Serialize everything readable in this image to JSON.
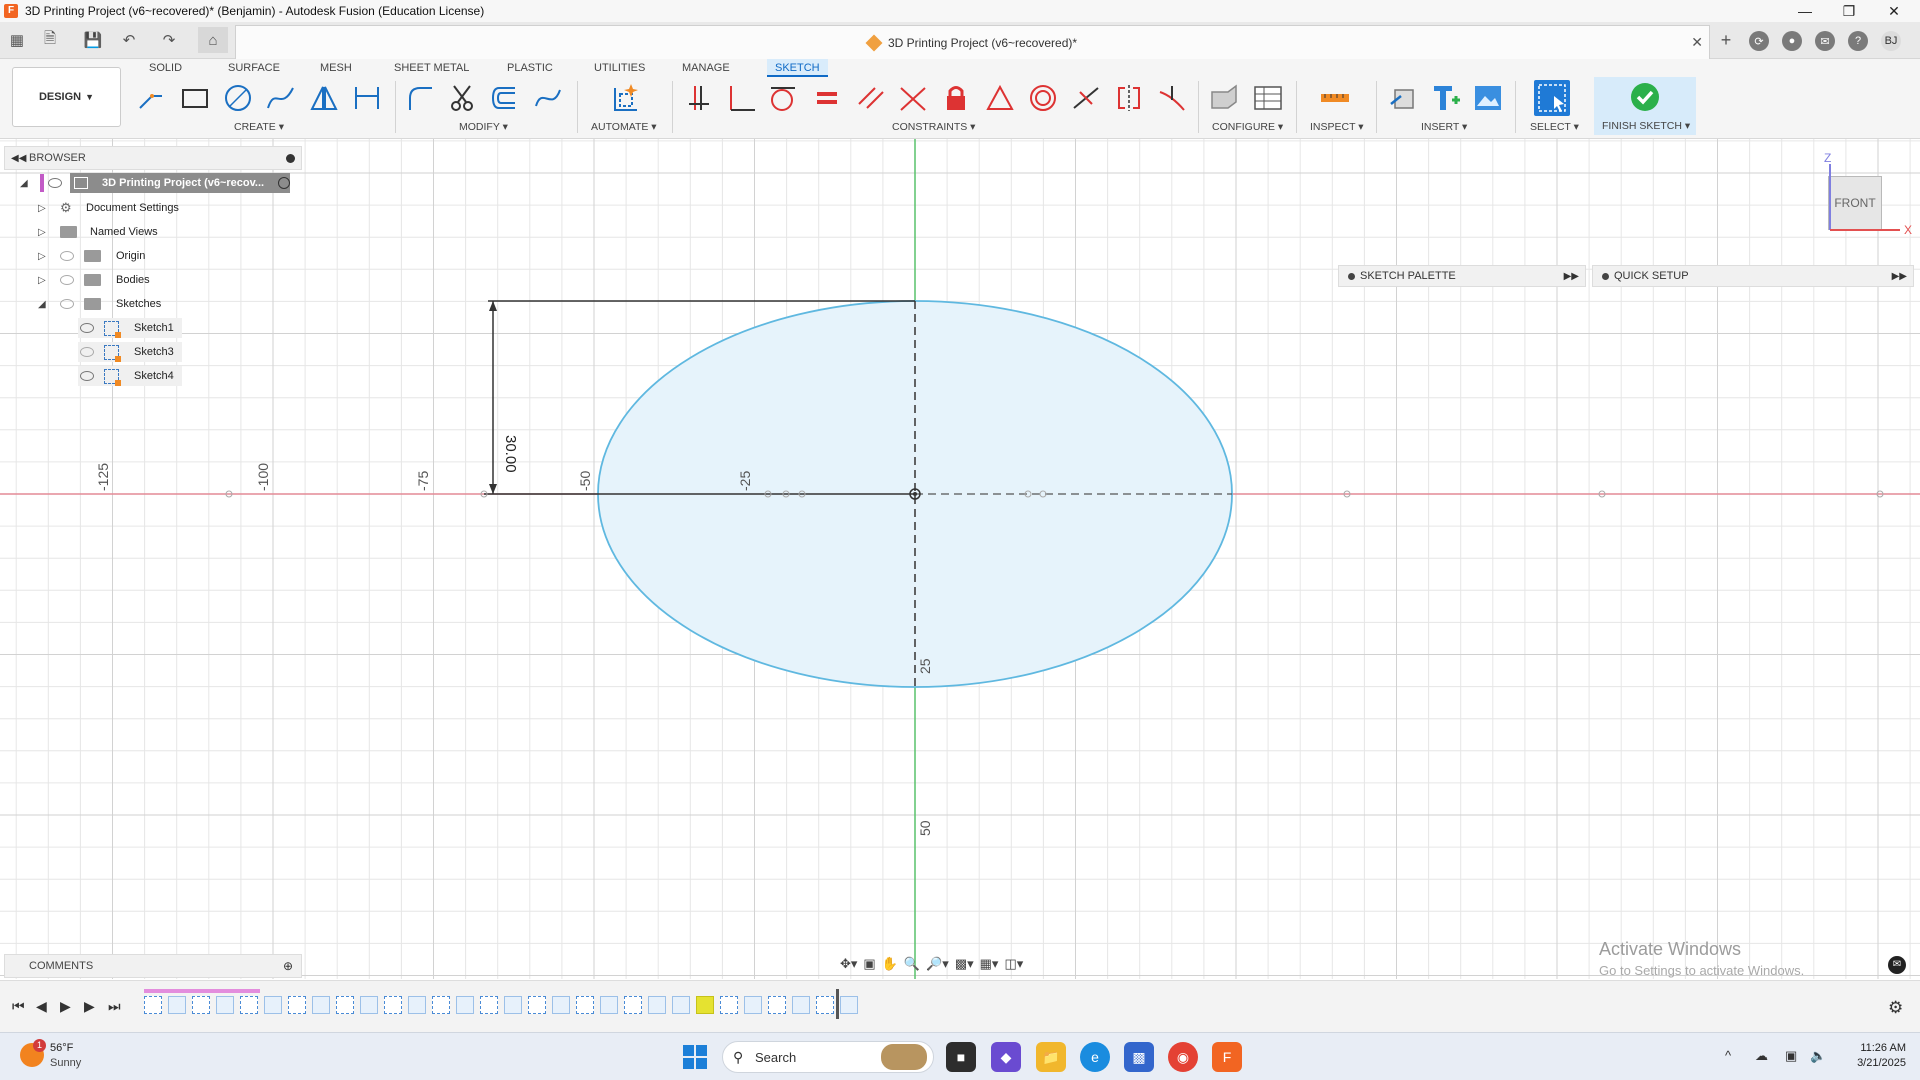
{
  "window": {
    "title": "3D Printing Project (v6~recovered)* (Benjamin) - Autodesk Fusion (Education License)",
    "app_icon": "F"
  },
  "doc_tab": {
    "title": "3D Printing Project (v6~recovered)*"
  },
  "user_initials": "BJ",
  "ribbon": {
    "tabs": [
      "SOLID",
      "SURFACE",
      "MESH",
      "SHEET METAL",
      "PLASTIC",
      "UTILITIES",
      "MANAGE",
      "SKETCH"
    ],
    "active_tab": "SKETCH",
    "workspace": "DESIGN",
    "groups": [
      "CREATE",
      "MODIFY",
      "AUTOMATE",
      "CONSTRAINTS",
      "CONFIGURE",
      "INSPECT",
      "INSERT",
      "SELECT"
    ],
    "finish_sketch": "FINISH SKETCH",
    "accent": "#0f6ac6",
    "finish_color": "#2bb04a"
  },
  "browser": {
    "title": "BROWSER",
    "root": "3D Printing Project (v6~recov...",
    "items": [
      {
        "label": "Document Settings"
      },
      {
        "label": "Named Views"
      },
      {
        "label": "Origin"
      },
      {
        "label": "Bodies"
      },
      {
        "label": "Sketches"
      }
    ],
    "sketches": [
      "Sketch1",
      "Sketch3",
      "Sketch4"
    ]
  },
  "palettes": {
    "sketch_palette": "SKETCH PALETTE",
    "quick_setup": "QUICK SETUP"
  },
  "viewcube": {
    "face": "FRONT",
    "axis_z": "Z",
    "axis_x": "X"
  },
  "canvas": {
    "x_axis_labels": [
      "-125",
      "-100",
      "-75",
      "-50",
      "-25"
    ],
    "y_axis_labels": [
      "25",
      "50"
    ],
    "dimension_label": "30.00",
    "ellipse_fill": "#e6f3fb",
    "ellipse_stroke": "#5fb8e0"
  },
  "comments": {
    "title": "COMMENTS"
  },
  "watermark": {
    "line1": "Activate Windows",
    "line2": "Go to Settings to activate Windows."
  },
  "taskbar": {
    "weather_temp": "56°F",
    "weather_desc": "Sunny",
    "weather_badge": "1",
    "search_placeholder": "Search",
    "time": "11:26 AM",
    "date": "3/21/2025"
  }
}
